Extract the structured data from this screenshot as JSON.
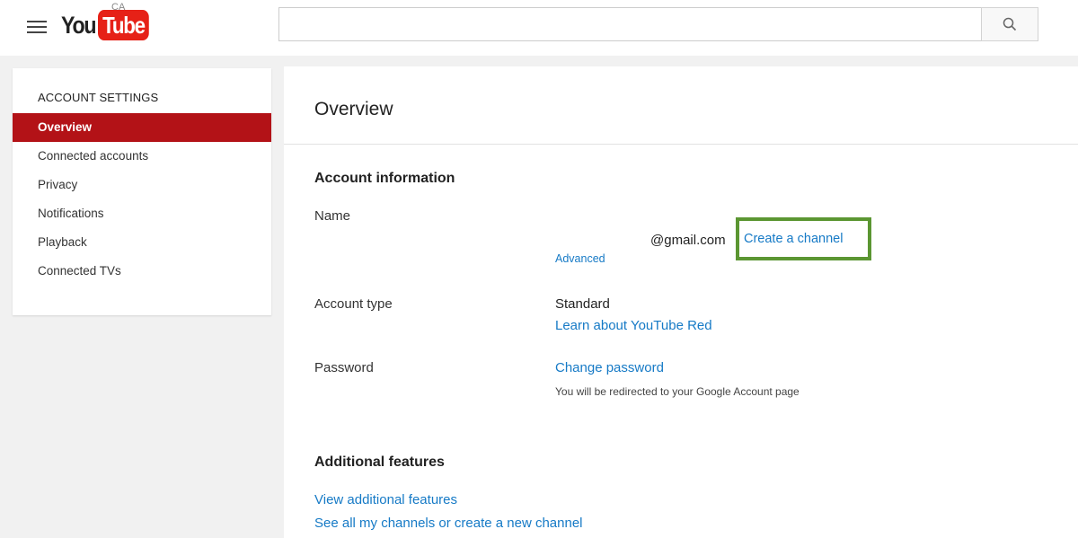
{
  "header": {
    "logo_you": "You",
    "logo_tube": "Tube",
    "region": "CA",
    "search_placeholder": ""
  },
  "sidebar": {
    "heading": "ACCOUNT SETTINGS",
    "items": [
      {
        "label": "Overview",
        "active": true
      },
      {
        "label": "Connected accounts"
      },
      {
        "label": "Privacy"
      },
      {
        "label": "Notifications"
      },
      {
        "label": "Playback"
      },
      {
        "label": "Connected TVs"
      }
    ]
  },
  "main": {
    "title": "Overview",
    "account_info": {
      "title": "Account information",
      "name_label": "Name",
      "email": "@gmail.com",
      "create_channel": "Create a channel",
      "advanced": "Advanced",
      "account_type_label": "Account type",
      "account_type_value": "Standard",
      "learn_red": "Learn about YouTube Red",
      "password_label": "Password",
      "change_password": "Change password",
      "redirect_note": "You will be redirected to your Google Account page"
    },
    "additional": {
      "title": "Additional features",
      "view_features": "View additional features",
      "see_channels": "See all my channels or create a new channel"
    }
  },
  "colors": {
    "brand_red": "#e62117",
    "sidebar_active": "#b31217",
    "link": "#167ac6",
    "highlight": "#5b9632"
  }
}
